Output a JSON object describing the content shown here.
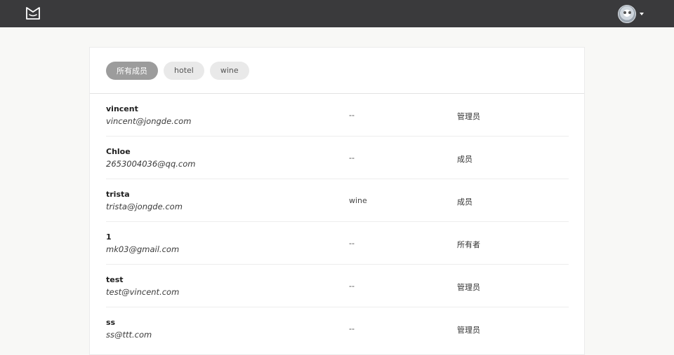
{
  "header": {
    "logo_icon": "app-logo-icon",
    "avatar_icon": "user-avatar-icon",
    "dropdown_icon": "caret-down-icon"
  },
  "tabs": [
    {
      "label": "所有成员",
      "active": true
    },
    {
      "label": "hotel",
      "active": false
    },
    {
      "label": "wine",
      "active": false
    }
  ],
  "members": [
    {
      "name": "vincent",
      "email": "vincent@jongde.com",
      "group": "--",
      "role": "管理员"
    },
    {
      "name": "Chloe",
      "email": "2653004036@qq.com",
      "group": "--",
      "role": "成员"
    },
    {
      "name": "trista",
      "email": "trista@jongde.com",
      "group": "wine",
      "role": "成员"
    },
    {
      "name": "1",
      "email": "mk03@gmail.com",
      "group": "--",
      "role": "所有者"
    },
    {
      "name": "test",
      "email": "test@vincent.com",
      "group": "--",
      "role": "管理员"
    },
    {
      "name": "ss",
      "email": "ss@ttt.com",
      "group": "--",
      "role": "管理员"
    }
  ],
  "colors": {
    "topbar": "#3a3a3c",
    "active_tab": "#9c9c9c",
    "inactive_tab": "#e9e9e9",
    "page_bg": "#f8f8f6"
  }
}
